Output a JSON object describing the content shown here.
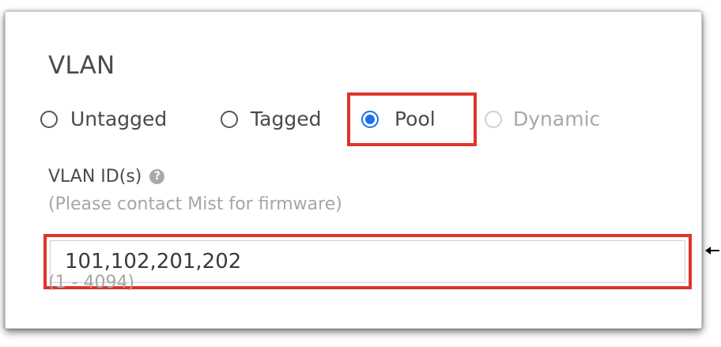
{
  "section": {
    "title": "VLAN"
  },
  "vlan_type": {
    "options": [
      {
        "label": "Untagged",
        "state": "unselected"
      },
      {
        "label": "Tagged",
        "state": "unselected"
      },
      {
        "label": "Pool",
        "state": "selected"
      },
      {
        "label": "Dynamic",
        "state": "disabled"
      }
    ],
    "selected": "Pool"
  },
  "vlan_ids": {
    "label": "VLAN ID(s)",
    "help_icon": "question-circle-icon",
    "help_glyph": "?",
    "note": "(Please contact Mist for firmware)",
    "value": "101,102,201,202",
    "range": "(1 - 4094)"
  },
  "colors": {
    "accent": "#1a73e8",
    "highlight_box": "#e0342b",
    "text_primary": "#4a4a4a",
    "text_muted": "#a6a6a6"
  }
}
